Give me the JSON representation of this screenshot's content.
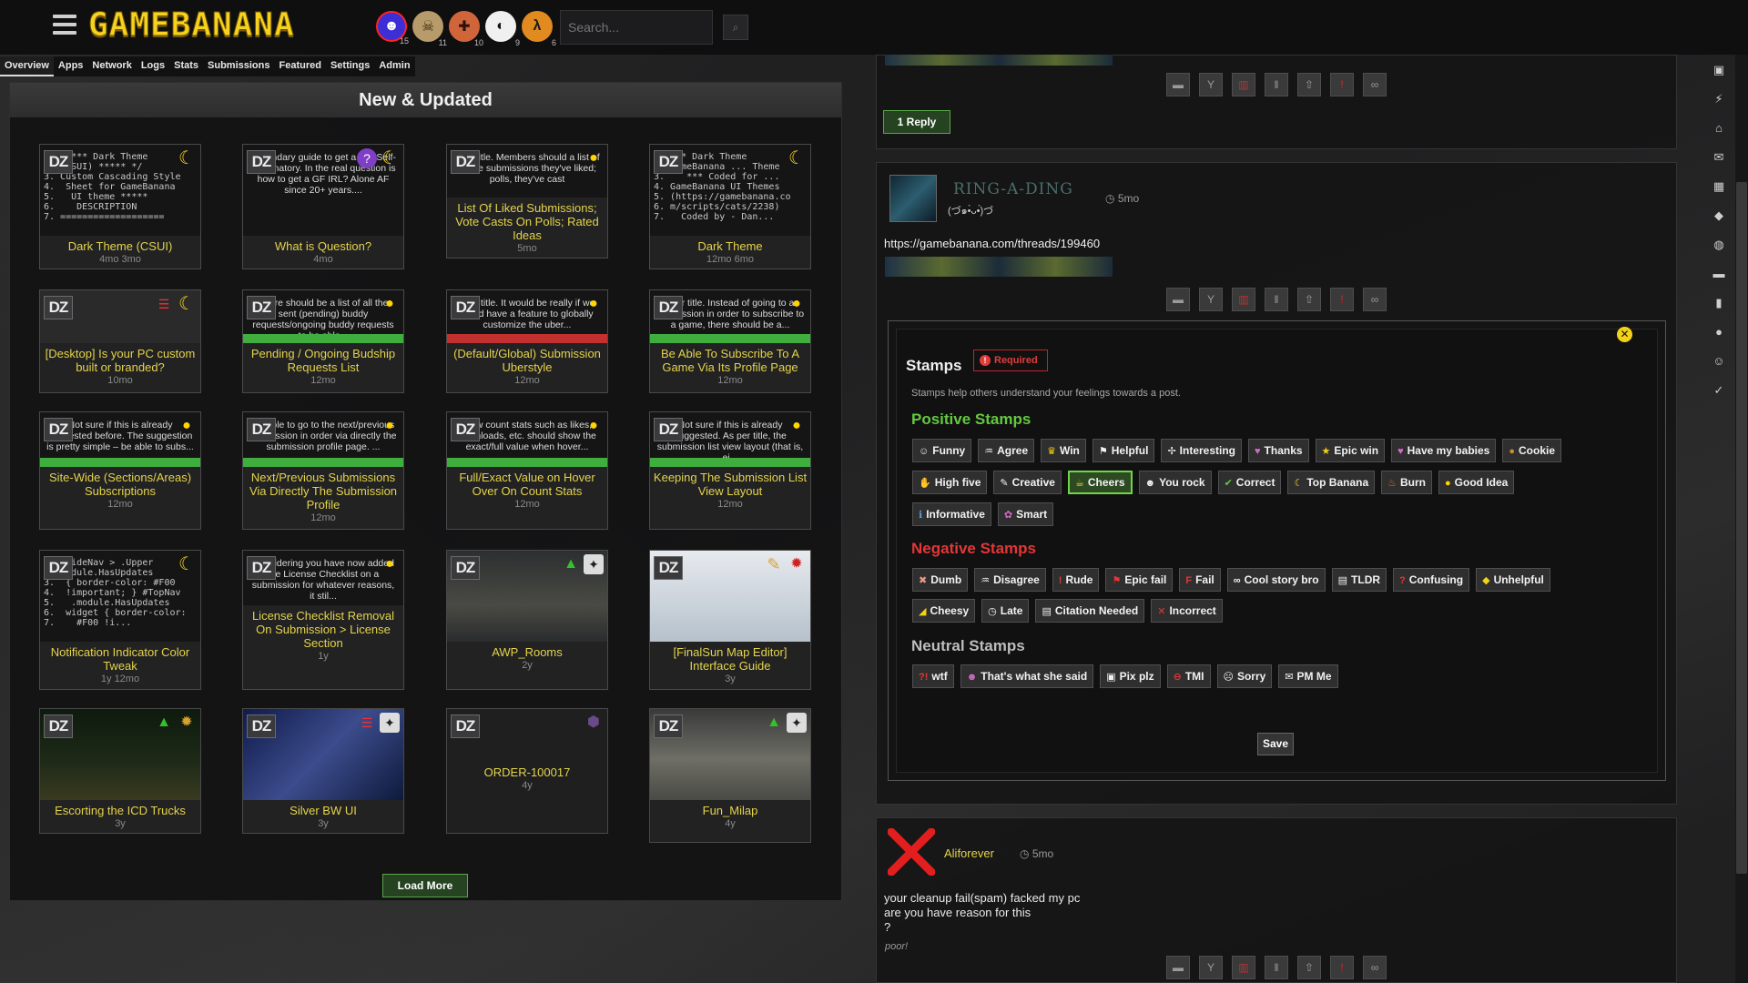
{
  "header": {
    "logo": "GAMEBANANA",
    "search_placeholder": "Search...",
    "games": [
      {
        "icon": "gb-mascot-icon",
        "count": "15"
      },
      {
        "icon": "skull-icon",
        "count": "11"
      },
      {
        "icon": "tf2-icon",
        "count": "10"
      },
      {
        "icon": "smash-icon",
        "count": "9"
      },
      {
        "icon": "half-life-icon",
        "count": "6"
      }
    ]
  },
  "subnav": [
    "Overview",
    "Apps",
    "Network",
    "Logs",
    "Stats",
    "Submissions",
    "Featured",
    "Settings",
    "Admin"
  ],
  "panel": {
    "title": "New & Updated",
    "load_more": "Load More",
    "cards": [
      {
        "title": "Dark Theme (CSUI)",
        "meta": "4mo  3mo",
        "snippet": "/* ***** Dark Theme\n   (CSUI) ***** */\n3. Custom Cascading Style\n4.  Sheet for GameBanana\n5.   UI theme *****\n6.    DESCRIPTION\n7. ==================="
      },
      {
        "title": "What is Question?",
        "meta": "4mo",
        "snippet": "Legendary guide to get a GF. Self-explanatory. In the real question is how to get a GF IRL? Alone AF since 20+ years...."
      },
      {
        "title": "List Of Liked Submissions; Vote Casts On Polls; Rated Ideas",
        "meta": "5mo",
        "snippet": "user title. Members should a list of all the submissions they've liked; polls, they've cast"
      },
      {
        "title": "Dark Theme",
        "meta": "12mo  6mo",
        "snippet": "/* *** Dark Theme\n   GameBanana ... Theme\n3.    *** Coded for ...\n4. GameBanana UI Themes\n5. (https://gamebanana.co\n6. m/scripts/cats/2238)\n7.   Coded by - Dan..."
      },
      {
        "title": "[Desktop] Is your PC custom built or branded?",
        "meta": "10mo",
        "snippet": ""
      },
      {
        "title": "Pending / Ongoing Budship Requests List",
        "meta": "12mo",
        "snippet": "There should be a list of all the sent (pending) buddy requests/ongoing buddy requests to be able..."
      },
      {
        "title": "(Default/Global) Submission Uberstyle",
        "meta": "12mo",
        "snippet": "user title. It would be really if we could have a feature to globally customize the uber..."
      },
      {
        "title": "Be Able To Subscribe To A Game Via Its Profile Page",
        "meta": "12mo",
        "snippet": "user title. Instead of going to a submission in order to subscribe to a game, there should be a..."
      },
      {
        "title": "Site-Wide (Sections/Areas) Subscriptions",
        "meta": "12mo",
        "snippet": "Not sure if this is already suggested before. The suggestion is pretty simple – be able to subs..."
      },
      {
        "title": "Next/Previous Submissions Via Directly The Submission Profile",
        "meta": "12mo",
        "snippet": "Be able to go to the next/previous submission in order via directly the submission profile page. ..."
      },
      {
        "title": "Full/Exact Value on Hover Over On Count Stats",
        "meta": "12mo",
        "snippet": "View count stats such as likes, downloads, etc. should show the exact/full value when hover..."
      },
      {
        "title": "Keeping The Submission List View Layout",
        "meta": "12mo",
        "snippet": "Not sure if this is already suggested. As per title, the submission list view layout (that is, ei..."
      },
      {
        "title": "Notification Indicator Color Tweak",
        "meta": "1y  12mo",
        "snippet": "/* #SideNav > .Upper\n  .module.HasUpdates\n3.  { border-color: #F00\n4.  !important; } #TopNav\n5.   .module.HasUpdates\n6.  widget { border-color:\n7.    #F00 !i..."
      },
      {
        "title": "License Checklist Removal On Submission > License Section",
        "meta": "1y",
        "snippet": "Considering you have now added the License Checklist on a submission for whatever reasons, it stil..."
      },
      {
        "title": "AWP_Rooms",
        "meta": "2y",
        "snippet": ""
      },
      {
        "title": "[FinalSun Map Editor] Interface Guide",
        "meta": "3y",
        "snippet": ""
      },
      {
        "title": "Escorting the ICD Trucks",
        "meta": "3y",
        "snippet": ""
      },
      {
        "title": "Silver BW UI",
        "meta": "3y",
        "snippet": ""
      },
      {
        "title": "ORDER-100017",
        "meta": "4y",
        "snippet": ""
      },
      {
        "title": "Fun_Milap",
        "meta": "4y",
        "snippet": ""
      }
    ]
  },
  "thread": {
    "reply_button": "1 Reply",
    "post1": {
      "username": "RING-A-DING",
      "subname": "(づ๑•̀ᴗ•́)づ",
      "time": "5mo",
      "link": "https://gamebanana.com/threads/199460"
    },
    "post2": {
      "username": "Aliforever",
      "time": "5mo",
      "text_lines": [
        "your cleanup fail(spam) facked my pc",
        "are you have reason for this",
        "?"
      ],
      "signature": "poor!"
    },
    "action_icons": [
      "comment-icon",
      "thumbs-icon",
      "trash-icon",
      "pause-icon",
      "upload-icon",
      "flag-icon",
      "link-icon"
    ]
  },
  "stamps": {
    "title": "Stamps",
    "required": "Required",
    "description": "Stamps help others understand your feelings towards a post.",
    "positive_heading": "Positive Stamps",
    "negative_heading": "Negative Stamps",
    "neutral_heading": "Neutral Stamps",
    "positive_row1": [
      "Funny",
      "Agree",
      "Win",
      "Helpful",
      "Interesting",
      "Thanks",
      "Epic win",
      "Have my babies",
      "Cookie"
    ],
    "positive_row2": [
      "High five",
      "Creative",
      "Cheers",
      "You rock",
      "Correct",
      "Top Banana",
      "Burn",
      "Good Idea"
    ],
    "positive_row3": [
      "Informative",
      "Smart"
    ],
    "negative_row1": [
      "Dumb",
      "Disagree",
      "Rude",
      "Epic fail",
      "Fail",
      "Cool story bro",
      "TLDR",
      "Confusing",
      "Unhelpful"
    ],
    "negative_row2": [
      "Cheesy",
      "Late",
      "Citation Needed",
      "Incorrect"
    ],
    "neutral_row1": [
      "wtf",
      "That's what she said",
      "Pix plz",
      "TMI",
      "Sorry",
      "PM Me"
    ],
    "selected": "Cheers",
    "save": "Save"
  },
  "colors": {
    "accent_green": "#64c940",
    "accent_red": "#e43636",
    "accent_yellow": "#f4d218",
    "title_yellow": "#e4d34a"
  }
}
